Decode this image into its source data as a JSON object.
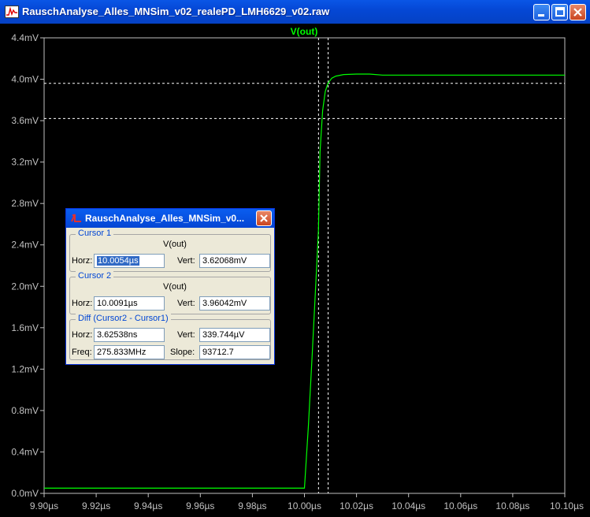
{
  "window": {
    "title": "RauschAnalyse_Alles_MNSim_v02_realePD_LMH6629_v02.raw"
  },
  "plot": {
    "trace_label": "V(out)",
    "background": "#000000",
    "trace_color": "#00ff00",
    "axis_color": "#c0c0c0"
  },
  "chart_data": {
    "type": "line",
    "series": [
      {
        "name": "V(out)",
        "x": [
          9.9,
          10.0,
          10.0015,
          10.003,
          10.0045,
          10.0054,
          10.006,
          10.007,
          10.008,
          10.009,
          10.0105,
          10.012,
          10.015,
          10.02,
          10.025,
          10.03,
          10.05,
          10.1
        ],
        "y": [
          0.05,
          0.05,
          0.65,
          1.35,
          2.1,
          2.55,
          3.3,
          3.7,
          3.88,
          3.96,
          4.01,
          4.03,
          4.045,
          4.05,
          4.05,
          4.04,
          4.04,
          4.04
        ]
      }
    ],
    "xlim": [
      9.9,
      10.1
    ],
    "ylim": [
      0.0,
      4.4
    ],
    "x_unit": "µs",
    "y_unit": "mV",
    "x_ticks": [
      "9.90µs",
      "9.92µs",
      "9.94µs",
      "9.96µs",
      "9.98µs",
      "10.00µs",
      "10.02µs",
      "10.04µs",
      "10.06µs",
      "10.08µs",
      "10.10µs"
    ],
    "x_tick_values": [
      9.9,
      9.92,
      9.94,
      9.96,
      9.98,
      10.0,
      10.02,
      10.04,
      10.06,
      10.08,
      10.1
    ],
    "y_ticks": [
      "0.0mV",
      "0.4mV",
      "0.8mV",
      "1.2mV",
      "1.6mV",
      "2.0mV",
      "2.4mV",
      "2.8mV",
      "3.2mV",
      "3.6mV",
      "4.0mV",
      "4.4mV"
    ],
    "y_tick_values": [
      0.0,
      0.4,
      0.8,
      1.2,
      1.6,
      2.0,
      2.4,
      2.8,
      3.2,
      3.6,
      4.0,
      4.4
    ],
    "grid": false,
    "cursors": [
      {
        "x": 10.0054,
        "y": 3.62068
      },
      {
        "x": 10.0091,
        "y": 3.96042
      }
    ]
  },
  "dialog": {
    "title": "RauschAnalyse_Alles_MNSim_v0...",
    "cursor1": {
      "legend": "Cursor 1",
      "column": "V(out)",
      "horz_label": "Horz:",
      "horz_value": "10.0054µs",
      "vert_label": "Vert:",
      "vert_value": "3.62068mV"
    },
    "cursor2": {
      "legend": "Cursor 2",
      "column": "V(out)",
      "horz_label": "Horz:",
      "horz_value": "10.0091µs",
      "vert_label": "Vert:",
      "vert_value": "3.96042mV"
    },
    "diff": {
      "legend": "Diff (Cursor2 - Cursor1)",
      "horz_label": "Horz:",
      "horz_value": "3.62538ns",
      "vert_label": "Vert:",
      "vert_value": "339.744µV",
      "freq_label": "Freq:",
      "freq_value": "275.833MHz",
      "slope_label": "Slope:",
      "slope_value": "93712.7"
    }
  }
}
